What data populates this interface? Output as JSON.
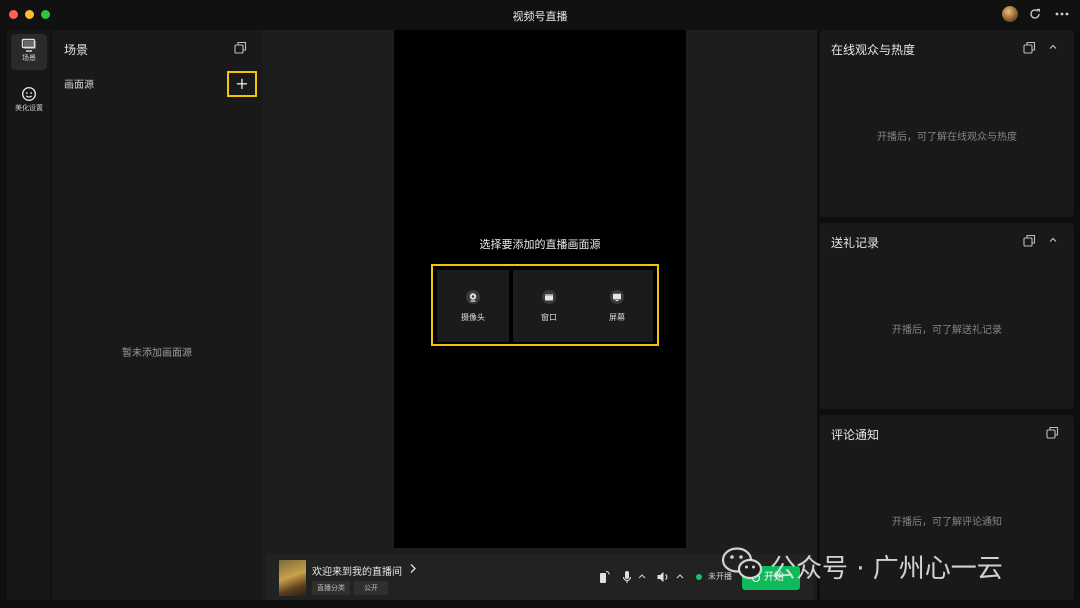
{
  "window": {
    "title": "视频号直播"
  },
  "nav": [
    {
      "label": "场景",
      "icon": "scene-monitor-icon",
      "active": true
    },
    {
      "label": "美化设置",
      "icon": "beauty-face-icon",
      "active": false
    }
  ],
  "scene": {
    "title": "场景",
    "source_label": "画面源",
    "add_label": "+",
    "empty_text": "暂未添加画面源"
  },
  "preview": {
    "choose_title": "选择要添加的直播画面源",
    "options": [
      {
        "label": "摄像头",
        "icon": "camera-icon"
      },
      {
        "label": "窗口",
        "icon": "window-icon"
      },
      {
        "label": "屏幕",
        "icon": "screen-icon"
      }
    ]
  },
  "bottom": {
    "room_title": "欢迎来到我的直播间",
    "category_chip": "直播分类",
    "public_chip": "公开",
    "status_text": "未开播",
    "start_label": "开始"
  },
  "panels": [
    {
      "title": "在线观众与热度",
      "empty_text": "开播后，可了解在线观众与热度",
      "collapsible": true
    },
    {
      "title": "送礼记录",
      "empty_text": "开播后，可了解送礼记录",
      "collapsible": true
    },
    {
      "title": "评论通知",
      "empty_text": "开播后，可了解评论通知",
      "collapsible": false
    }
  ],
  "watermark": {
    "text": "公众号 · 广州心一云"
  },
  "colors": {
    "accent_green": "#0fba5a",
    "highlight_yellow": "#f5c400",
    "status_green": "#14c36a"
  }
}
